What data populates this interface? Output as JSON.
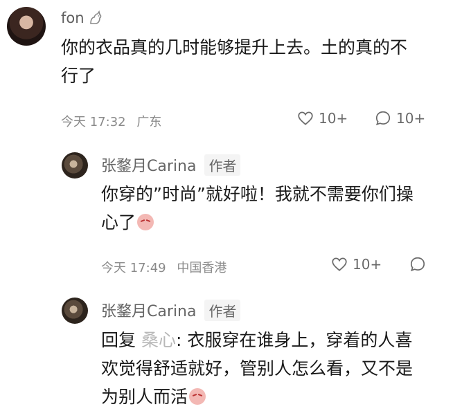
{
  "comment": {
    "username": "fon",
    "text_line1": "你的衣品真的几时能够提升上去。土的真的不",
    "text_line2": "行了",
    "time": "今天 17:32",
    "location": "广东",
    "like_count": "10+",
    "reply_count": "10+"
  },
  "reply1": {
    "username": "张鍪月Carina",
    "badge": "作者",
    "text_line1": "你穿的”时尚”就好啦！我就不需要你们操",
    "text_line2": "心了",
    "time": "今天 17:49",
    "location": "中国香港",
    "like_count": "10+"
  },
  "reply2": {
    "username": "张鍪月Carina",
    "badge": "作者",
    "reply_prefix": "回复",
    "reply_to": "桑心",
    "text_line1_rest": ": 衣服穿在谁身上，穿着的人喜",
    "text_line2": "欢觉得舒适就好，管别人怎么看，又不是",
    "text_line3": "为别人而活"
  },
  "icons": {
    "like": "heart-icon",
    "comment": "comment-bubble-icon",
    "user_badge": "cat-icon",
    "emoji": "smirk-emoji"
  }
}
